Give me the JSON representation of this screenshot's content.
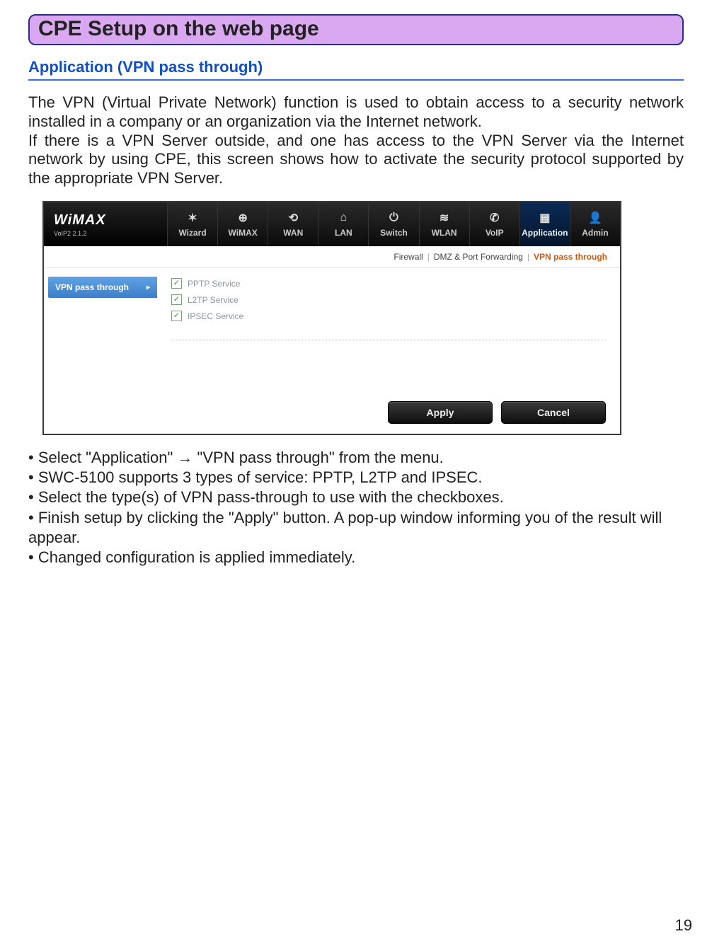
{
  "title_box": "CPE Setup on the web page",
  "section_heading": "Application (VPN pass through)",
  "para1": "The VPN (Virtual Private Network) function is used to obtain access to a security network installed in a company or an organization via the Internet network.",
  "para2": "If there is a VPN Server outside, and one has access to the VPN Server via the Internet network by using CPE, this screen shows how to activate the security protocol supported by the appropriate VPN Server.",
  "screenshot": {
    "logo_main": "WiMAX",
    "logo_sub": "VoIP2 2.1.2",
    "nav": [
      {
        "label": "Wizard",
        "icon": "✶"
      },
      {
        "label": "WiMAX",
        "icon": "⊕"
      },
      {
        "label": "WAN",
        "icon": "⟲"
      },
      {
        "label": "LAN",
        "icon": "⌂"
      },
      {
        "label": "Switch",
        "icon": "⏻"
      },
      {
        "label": "WLAN",
        "icon": "≋"
      },
      {
        "label": "VoIP",
        "icon": "✆"
      },
      {
        "label": "Application",
        "icon": "▦",
        "active": true
      },
      {
        "label": "Admin",
        "icon": "👤"
      }
    ],
    "subtabs": {
      "t1": "Firewall",
      "t2": "DMZ & Port Forwarding",
      "t3": "VPN pass through"
    },
    "sidebar_label": "VPN pass through",
    "options": {
      "o1": "PPTP Service",
      "o2": "L2TP Service",
      "o3": "IPSEC Service"
    },
    "buttons": {
      "apply": "Apply",
      "cancel": "Cancel"
    }
  },
  "bullets": {
    "b1": "• Select \"Application\" → \"VPN pass through\" from the menu.",
    "b2": "• SWC-5100 supports 3 types of service: PPTP, L2TP and IPSEC.",
    "b3": "• Select the type(s) of VPN pass-through to use with the checkboxes.",
    "b4": "• Finish setup by clicking the \"Apply\" button. A pop-up window informing you of the result will appear.",
    "b5": "• Changed configuration is applied immediately."
  },
  "page_number": "19"
}
